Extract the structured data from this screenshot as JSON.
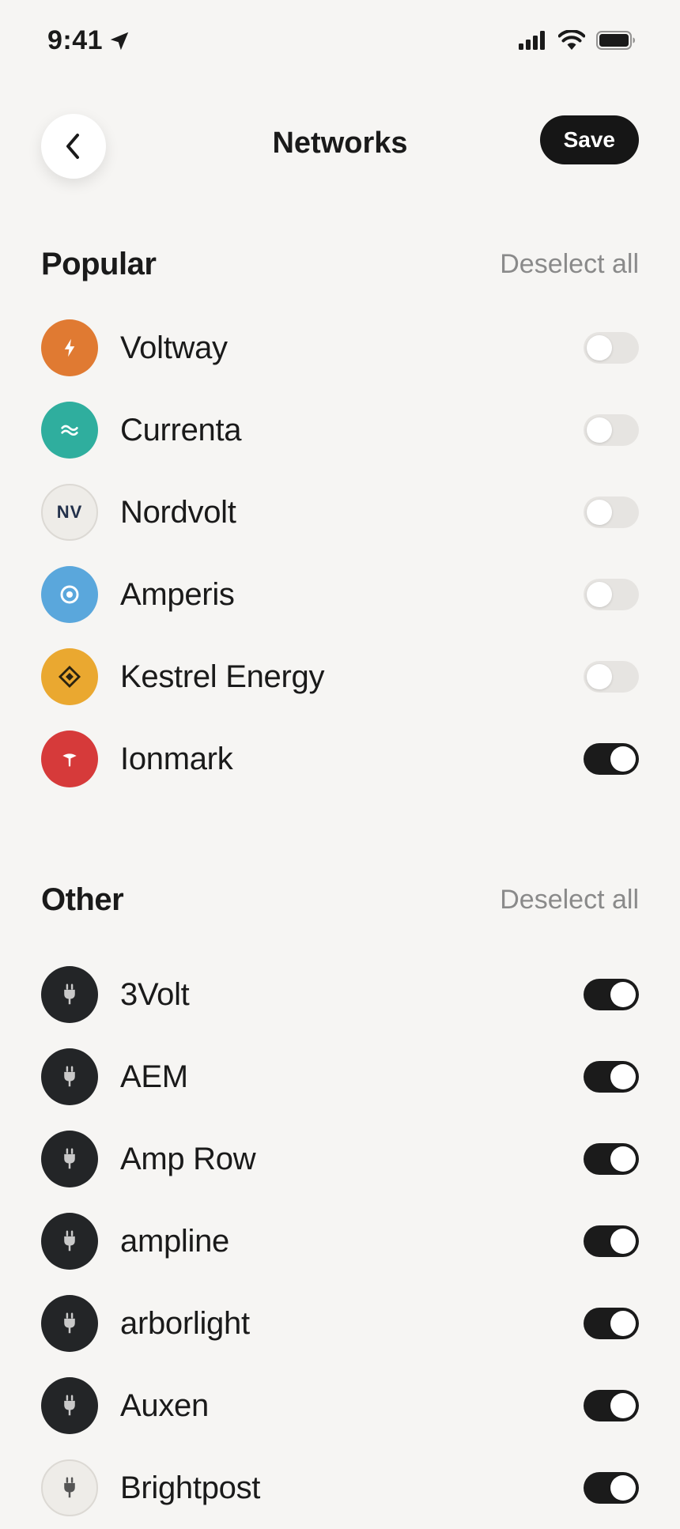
{
  "status_bar": {
    "time": "9:41"
  },
  "header": {
    "title": "Networks",
    "save_label": "Save"
  },
  "sections": {
    "popular": {
      "title": "Popular",
      "deselect_label": "Deselect all",
      "items": [
        {
          "name": "Voltway",
          "icon": "bolt-icon",
          "color": "#e07a32",
          "enabled": false
        },
        {
          "name": "Currenta",
          "icon": "wave-icon",
          "color": "#2fae9e",
          "enabled": false
        },
        {
          "name": "Nordvolt",
          "icon_text": "NV",
          "color": "#eeece8",
          "enabled": false
        },
        {
          "name": "Amperis",
          "icon": "target-icon",
          "color": "#5aa7dc",
          "enabled": false
        },
        {
          "name": "Kestrel Energy",
          "icon": "diamond-icon",
          "color": "#eaa830",
          "enabled": false
        },
        {
          "name": "Ionmark",
          "icon": "pin-icon",
          "color": "#d63a3a",
          "enabled": true
        }
      ]
    },
    "other": {
      "title": "Other",
      "deselect_label": "Deselect all",
      "items": [
        {
          "name": "3Volt",
          "icon": "plug-icon",
          "color": "#232527",
          "enabled": true
        },
        {
          "name": "AEM",
          "icon": "plug-icon",
          "color": "#232527",
          "enabled": true
        },
        {
          "name": "Amp Row",
          "icon": "plug-icon",
          "color": "#232527",
          "enabled": true
        },
        {
          "name": "ampline",
          "icon": "plug-icon",
          "color": "#232527",
          "enabled": true
        },
        {
          "name": "arborlight",
          "icon": "plug-icon",
          "color": "#232527",
          "enabled": true
        },
        {
          "name": "Auxen",
          "icon": "plug-icon",
          "color": "#232527",
          "enabled": true
        },
        {
          "name": "Brightpost",
          "icon": "plug-icon",
          "color": "#eeece8",
          "enabled": true
        }
      ]
    }
  },
  "colors": {
    "background": "#f6f5f3",
    "accent_dark": "#161616",
    "muted_text": "#8a8a8a",
    "toggle_off": "#e6e4e1"
  }
}
